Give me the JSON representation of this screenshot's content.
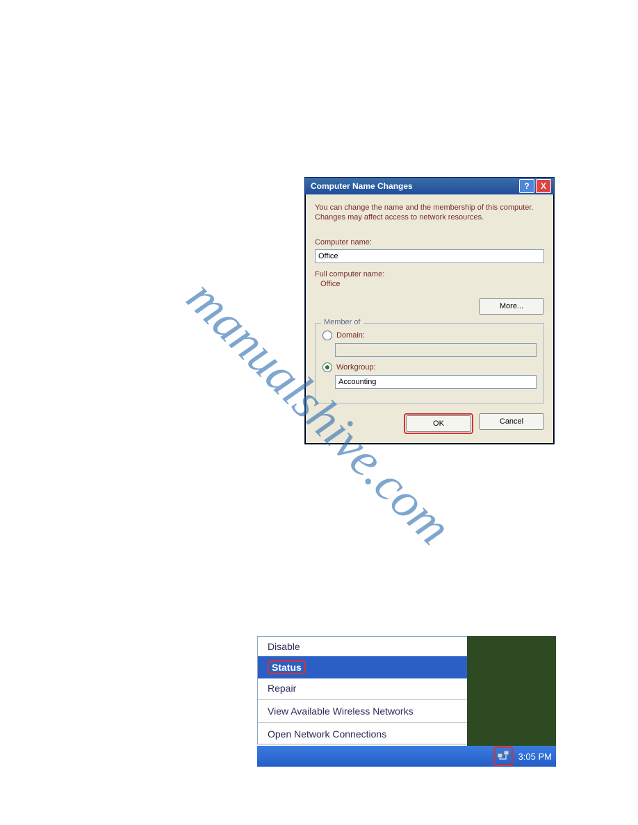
{
  "watermark": "manualshive.com",
  "nav_links": [
    "",
    ""
  ],
  "dialog": {
    "title": "Computer Name Changes",
    "description": "You can change the name and the membership of this computer. Changes may affect access to network resources.",
    "computer_name_label": "Computer name:",
    "computer_name_value": "Office",
    "full_name_label": "Full computer name:",
    "full_name_value": "Office",
    "more_label": "More...",
    "member_of_legend": "Member of",
    "domain_label": "Domain:",
    "domain_value": "",
    "workgroup_label": "Workgroup:",
    "workgroup_value": "Accounting",
    "ok_label": "OK",
    "cancel_label": "Cancel"
  },
  "context_menu": {
    "items": [
      {
        "label": "Disable",
        "selected": false
      },
      {
        "label": "Status",
        "selected": true
      },
      {
        "label": "Repair",
        "selected": false
      }
    ],
    "wireless_label": "View Available Wireless Networks",
    "open_conn_label": "Open Network Connections"
  },
  "taskbar": {
    "time": "3:05 PM"
  }
}
